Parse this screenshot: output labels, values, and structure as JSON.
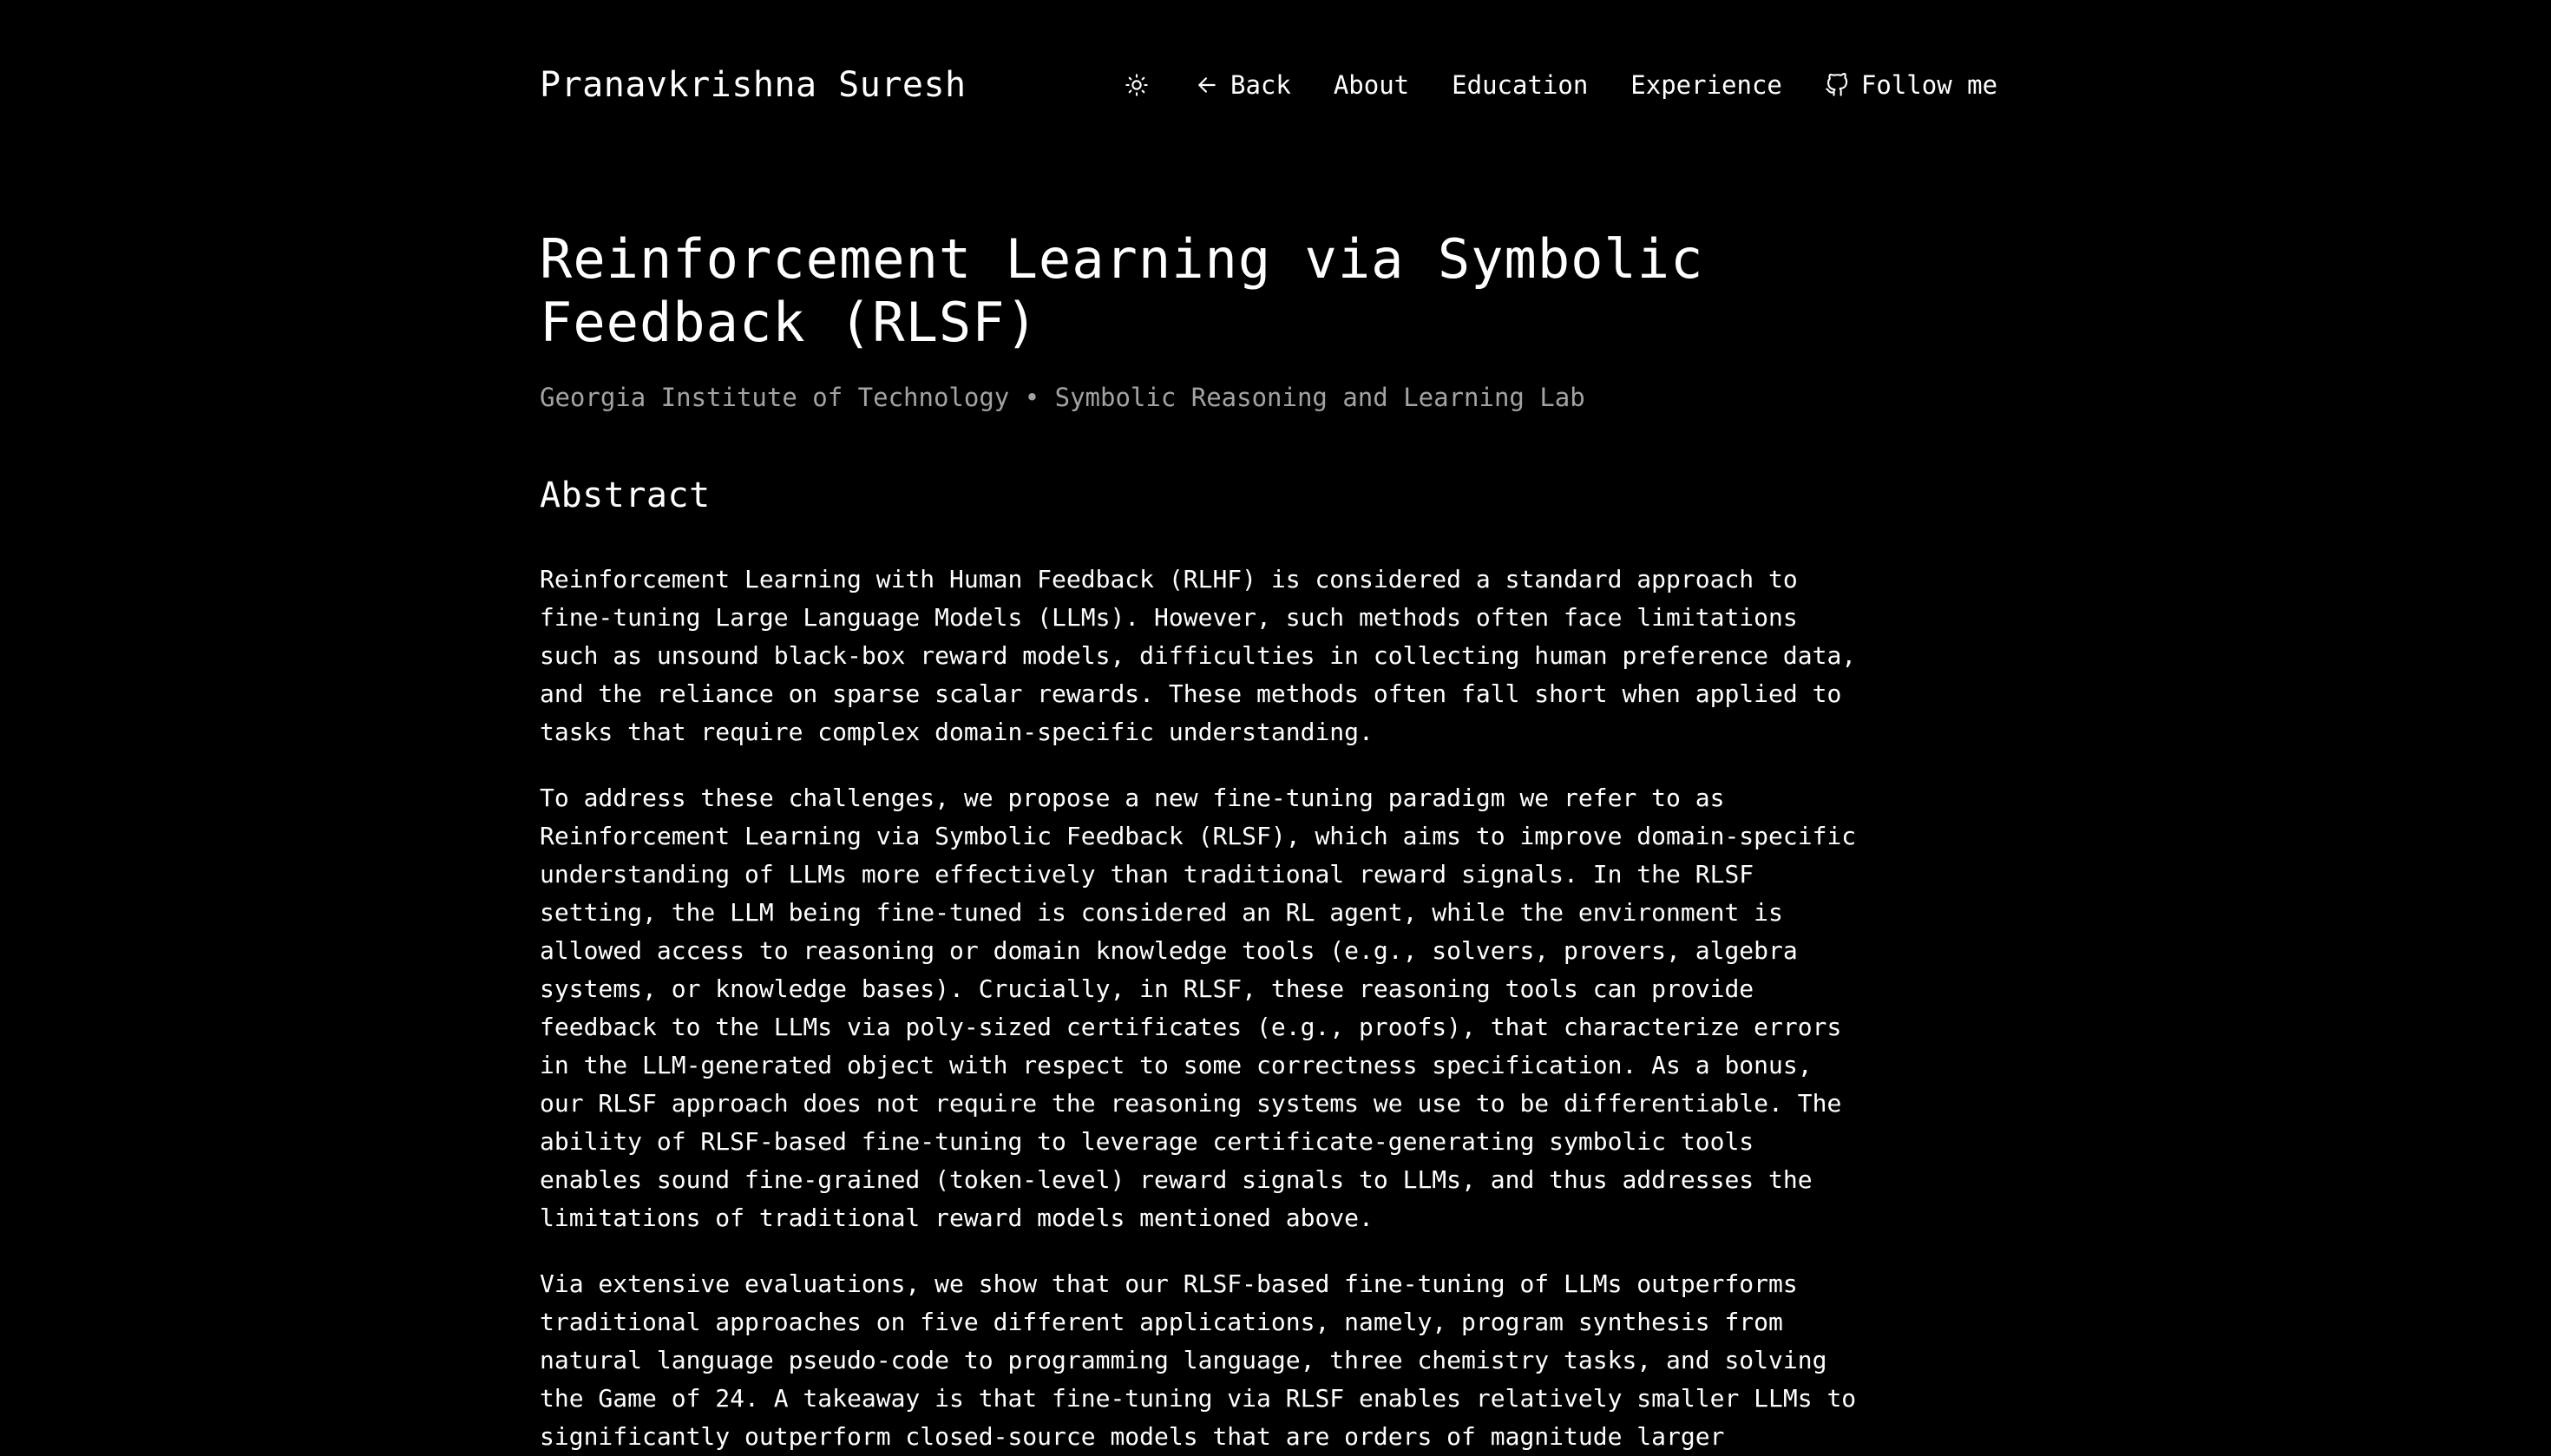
{
  "header": {
    "site_title": "Pranavkrishna Suresh",
    "theme_icon": "sun-icon",
    "nav": {
      "back": "Back",
      "about": "About",
      "education": "Education",
      "experience": "Experience",
      "follow": "Follow me"
    }
  },
  "article": {
    "title": "Reinforcement Learning via Symbolic Feedback (RLSF)",
    "subtitle": "Georgia Institute of Technology • Symbolic Reasoning and Learning Lab",
    "section_heading": "Abstract",
    "paragraphs": [
      "Reinforcement Learning with Human Feedback (RLHF) is considered a standard approach to fine-tuning Large Language Models (LLMs). However, such methods often face limitations such as unsound black-box reward models, difficulties in collecting human preference data, and the reliance on sparse scalar rewards. These methods often fall short when applied to tasks that require complex domain-specific understanding.",
      "To address these challenges, we propose a new fine-tuning paradigm we refer to as Reinforcement Learning via Symbolic Feedback (RLSF), which aims to improve domain-specific understanding of LLMs more effectively than traditional reward signals. In the RLSF setting, the LLM being fine-tuned is considered an RL agent, while the environment is allowed access to reasoning or domain knowledge tools (e.g., solvers, provers, algebra systems, or knowledge bases). Crucially, in RLSF, these reasoning tools can provide feedback to the LLMs via poly-sized certificates (e.g., proofs), that characterize errors in the LLM-generated object with respect to some correctness specification. As a bonus, our RLSF approach does not require the reasoning systems we use to be differentiable. The ability of RLSF-based fine-tuning to leverage certificate-generating symbolic tools enables sound fine-grained (token-level) reward signals to LLMs, and thus addresses the limitations of traditional reward models mentioned above.",
      "Via extensive evaluations, we show that our RLSF-based fine-tuning of LLMs outperforms traditional approaches on five different applications, namely, program synthesis from natural language pseudo-code to programming language, three chemistry tasks, and solving the Game of 24. A takeaway is that fine-tuning via RLSF enables relatively smaller LLMs to significantly outperform closed-source models that are orders of magnitude larger"
    ]
  }
}
